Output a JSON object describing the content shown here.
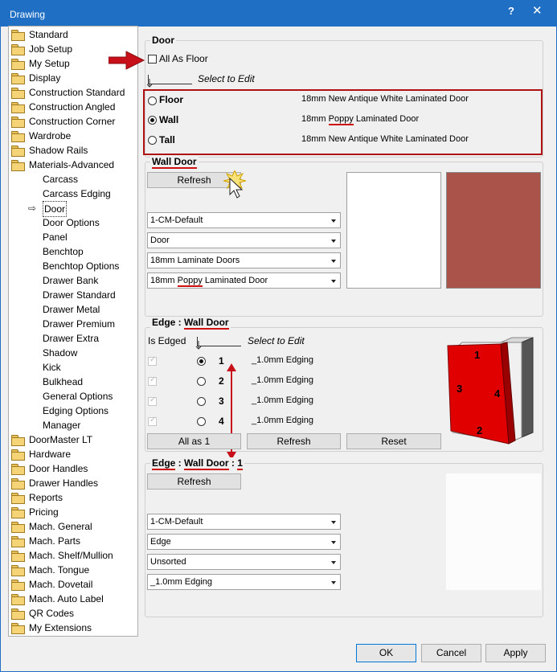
{
  "window": {
    "title": "Drawing",
    "help_glyph": "?",
    "close_glyph": "✕"
  },
  "tree": {
    "items": [
      {
        "label": "Standard",
        "level": 0,
        "icon": "folder-icon"
      },
      {
        "label": "Job Setup",
        "level": 0,
        "icon": "folder-icon"
      },
      {
        "label": "My Setup",
        "level": 0,
        "icon": "folder-icon"
      },
      {
        "label": "Display",
        "level": 0,
        "icon": "folder-icon"
      },
      {
        "label": "Construction Standard",
        "level": 0,
        "icon": "folder-icon"
      },
      {
        "label": "Construction Angled",
        "level": 0,
        "icon": "folder-icon"
      },
      {
        "label": "Construction Corner",
        "level": 0,
        "icon": "folder-icon"
      },
      {
        "label": "Wardrobe",
        "level": 0,
        "icon": "folder-icon"
      },
      {
        "label": "Shadow Rails",
        "level": 0,
        "icon": "folder-icon"
      },
      {
        "label": "Materials-Advanced",
        "level": 0,
        "icon": "folder-icon"
      },
      {
        "label": "Carcass",
        "level": 1
      },
      {
        "label": "Carcass Edging",
        "level": 1
      },
      {
        "label": "Door",
        "level": 1,
        "selected": true
      },
      {
        "label": "Door Options",
        "level": 1
      },
      {
        "label": "Panel",
        "level": 1
      },
      {
        "label": "Benchtop",
        "level": 1
      },
      {
        "label": "Benchtop Options",
        "level": 1
      },
      {
        "label": "Drawer Bank",
        "level": 1
      },
      {
        "label": "Drawer Standard",
        "level": 1
      },
      {
        "label": "Drawer Metal",
        "level": 1
      },
      {
        "label": "Drawer Premium",
        "level": 1
      },
      {
        "label": "Drawer Extra",
        "level": 1
      },
      {
        "label": "Shadow",
        "level": 1
      },
      {
        "label": "Kick",
        "level": 1
      },
      {
        "label": "Bulkhead",
        "level": 1
      },
      {
        "label": "General Options",
        "level": 1
      },
      {
        "label": "Edging Options",
        "level": 1
      },
      {
        "label": "Manager",
        "level": 1
      },
      {
        "label": "DoorMaster LT",
        "level": 0,
        "icon": "folder-icon"
      },
      {
        "label": "Hardware",
        "level": 0,
        "icon": "folder-icon"
      },
      {
        "label": "Door Handles",
        "level": 0,
        "icon": "folder-icon"
      },
      {
        "label": "Drawer Handles",
        "level": 0,
        "icon": "folder-icon"
      },
      {
        "label": "Reports",
        "level": 0,
        "icon": "folder-icon"
      },
      {
        "label": "Pricing",
        "level": 0,
        "icon": "folder-icon"
      },
      {
        "label": "Mach. General",
        "level": 0,
        "icon": "folder-icon"
      },
      {
        "label": "Mach. Parts",
        "level": 0,
        "icon": "folder-icon"
      },
      {
        "label": "Mach. Shelf/Mullion",
        "level": 0,
        "icon": "folder-icon"
      },
      {
        "label": "Mach. Tongue",
        "level": 0,
        "icon": "folder-icon"
      },
      {
        "label": "Mach. Dovetail",
        "level": 0,
        "icon": "folder-icon"
      },
      {
        "label": "Mach. Auto Label",
        "level": 0,
        "icon": "folder-icon"
      },
      {
        "label": "QR Codes",
        "level": 0,
        "icon": "folder-icon"
      },
      {
        "label": "My Extensions",
        "level": 0,
        "icon": "folder-icon"
      }
    ]
  },
  "door": {
    "title": "Door",
    "all_as_floor": "All As Floor",
    "select_to_edit": "Select to Edit",
    "rows": [
      {
        "name": "Floor",
        "value": "18mm New Antique White Laminated Door",
        "checked": false
      },
      {
        "name": "Wall",
        "value_pre": "18mm ",
        "value_hl": "Poppy",
        "value_post": " Laminated Door",
        "checked": true
      },
      {
        "name": "Tall",
        "value": "18mm New Antique White Laminated Door",
        "checked": false
      }
    ]
  },
  "wall_door": {
    "title": "Wall Door",
    "refresh": "Refresh",
    "combos": [
      "1-CM-Default",
      "Door",
      "18mm Laminate Doors"
    ],
    "combo4_pre": "18mm ",
    "combo4_hl": "Poppy",
    "combo4_post": " Laminated Door",
    "swatch_color": "#a9534b"
  },
  "edge": {
    "title_pre": "Edge : ",
    "title_hl": "Wall Door",
    "is_edged": "Is Edged",
    "select_to_edit": "Select to Edit",
    "rows": [
      {
        "num": "1",
        "edging": "_1.0mm Edging",
        "checked": true
      },
      {
        "num": "2",
        "edging": "_1.0mm Edging",
        "checked": false
      },
      {
        "num": "3",
        "edging": "_1.0mm Edging",
        "checked": false
      },
      {
        "num": "4",
        "edging": "_1.0mm Edging",
        "checked": false
      }
    ],
    "all_as_1": "All as 1",
    "refresh": "Refresh",
    "reset": "Reset",
    "preview_labels": [
      "1",
      "2",
      "3",
      "4"
    ],
    "door_color": "#e00000"
  },
  "edge1": {
    "t1": "Edge",
    "t2": " : ",
    "t3": "Wall Door",
    "t4": " : ",
    "t5": "1",
    "refresh": "Refresh",
    "combos": [
      "1-CM-Default",
      "Edge",
      "Unsorted",
      "_1.0mm Edging"
    ]
  },
  "footer": {
    "ok": "OK",
    "cancel": "Cancel",
    "apply": "Apply"
  }
}
